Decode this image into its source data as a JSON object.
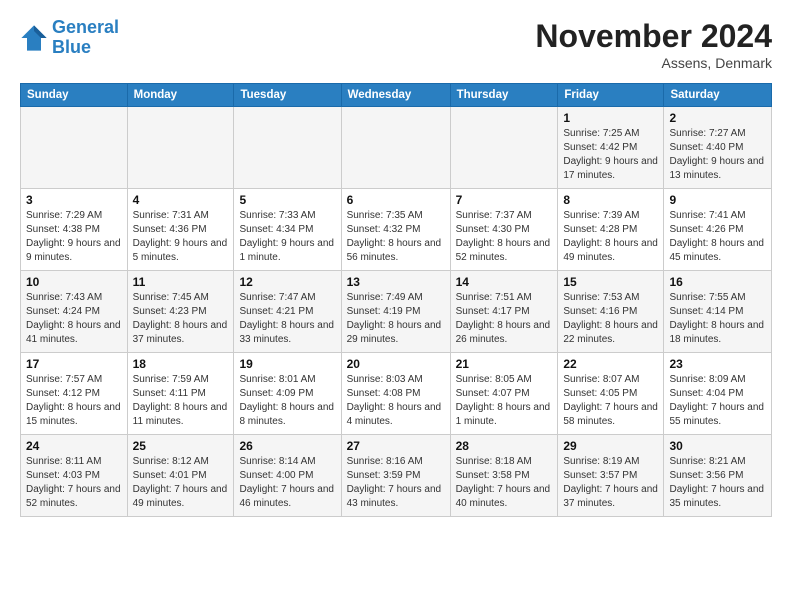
{
  "logo": {
    "line1": "General",
    "line2": "Blue"
  },
  "title": "November 2024",
  "location": "Assens, Denmark",
  "days_of_week": [
    "Sunday",
    "Monday",
    "Tuesday",
    "Wednesday",
    "Thursday",
    "Friday",
    "Saturday"
  ],
  "weeks": [
    [
      {
        "day": "",
        "info": ""
      },
      {
        "day": "",
        "info": ""
      },
      {
        "day": "",
        "info": ""
      },
      {
        "day": "",
        "info": ""
      },
      {
        "day": "",
        "info": ""
      },
      {
        "day": "1",
        "info": "Sunrise: 7:25 AM\nSunset: 4:42 PM\nDaylight: 9 hours and 17 minutes."
      },
      {
        "day": "2",
        "info": "Sunrise: 7:27 AM\nSunset: 4:40 PM\nDaylight: 9 hours and 13 minutes."
      }
    ],
    [
      {
        "day": "3",
        "info": "Sunrise: 7:29 AM\nSunset: 4:38 PM\nDaylight: 9 hours and 9 minutes."
      },
      {
        "day": "4",
        "info": "Sunrise: 7:31 AM\nSunset: 4:36 PM\nDaylight: 9 hours and 5 minutes."
      },
      {
        "day": "5",
        "info": "Sunrise: 7:33 AM\nSunset: 4:34 PM\nDaylight: 9 hours and 1 minute."
      },
      {
        "day": "6",
        "info": "Sunrise: 7:35 AM\nSunset: 4:32 PM\nDaylight: 8 hours and 56 minutes."
      },
      {
        "day": "7",
        "info": "Sunrise: 7:37 AM\nSunset: 4:30 PM\nDaylight: 8 hours and 52 minutes."
      },
      {
        "day": "8",
        "info": "Sunrise: 7:39 AM\nSunset: 4:28 PM\nDaylight: 8 hours and 49 minutes."
      },
      {
        "day": "9",
        "info": "Sunrise: 7:41 AM\nSunset: 4:26 PM\nDaylight: 8 hours and 45 minutes."
      }
    ],
    [
      {
        "day": "10",
        "info": "Sunrise: 7:43 AM\nSunset: 4:24 PM\nDaylight: 8 hours and 41 minutes."
      },
      {
        "day": "11",
        "info": "Sunrise: 7:45 AM\nSunset: 4:23 PM\nDaylight: 8 hours and 37 minutes."
      },
      {
        "day": "12",
        "info": "Sunrise: 7:47 AM\nSunset: 4:21 PM\nDaylight: 8 hours and 33 minutes."
      },
      {
        "day": "13",
        "info": "Sunrise: 7:49 AM\nSunset: 4:19 PM\nDaylight: 8 hours and 29 minutes."
      },
      {
        "day": "14",
        "info": "Sunrise: 7:51 AM\nSunset: 4:17 PM\nDaylight: 8 hours and 26 minutes."
      },
      {
        "day": "15",
        "info": "Sunrise: 7:53 AM\nSunset: 4:16 PM\nDaylight: 8 hours and 22 minutes."
      },
      {
        "day": "16",
        "info": "Sunrise: 7:55 AM\nSunset: 4:14 PM\nDaylight: 8 hours and 18 minutes."
      }
    ],
    [
      {
        "day": "17",
        "info": "Sunrise: 7:57 AM\nSunset: 4:12 PM\nDaylight: 8 hours and 15 minutes."
      },
      {
        "day": "18",
        "info": "Sunrise: 7:59 AM\nSunset: 4:11 PM\nDaylight: 8 hours and 11 minutes."
      },
      {
        "day": "19",
        "info": "Sunrise: 8:01 AM\nSunset: 4:09 PM\nDaylight: 8 hours and 8 minutes."
      },
      {
        "day": "20",
        "info": "Sunrise: 8:03 AM\nSunset: 4:08 PM\nDaylight: 8 hours and 4 minutes."
      },
      {
        "day": "21",
        "info": "Sunrise: 8:05 AM\nSunset: 4:07 PM\nDaylight: 8 hours and 1 minute."
      },
      {
        "day": "22",
        "info": "Sunrise: 8:07 AM\nSunset: 4:05 PM\nDaylight: 7 hours and 58 minutes."
      },
      {
        "day": "23",
        "info": "Sunrise: 8:09 AM\nSunset: 4:04 PM\nDaylight: 7 hours and 55 minutes."
      }
    ],
    [
      {
        "day": "24",
        "info": "Sunrise: 8:11 AM\nSunset: 4:03 PM\nDaylight: 7 hours and 52 minutes."
      },
      {
        "day": "25",
        "info": "Sunrise: 8:12 AM\nSunset: 4:01 PM\nDaylight: 7 hours and 49 minutes."
      },
      {
        "day": "26",
        "info": "Sunrise: 8:14 AM\nSunset: 4:00 PM\nDaylight: 7 hours and 46 minutes."
      },
      {
        "day": "27",
        "info": "Sunrise: 8:16 AM\nSunset: 3:59 PM\nDaylight: 7 hours and 43 minutes."
      },
      {
        "day": "28",
        "info": "Sunrise: 8:18 AM\nSunset: 3:58 PM\nDaylight: 7 hours and 40 minutes."
      },
      {
        "day": "29",
        "info": "Sunrise: 8:19 AM\nSunset: 3:57 PM\nDaylight: 7 hours and 37 minutes."
      },
      {
        "day": "30",
        "info": "Sunrise: 8:21 AM\nSunset: 3:56 PM\nDaylight: 7 hours and 35 minutes."
      }
    ]
  ]
}
